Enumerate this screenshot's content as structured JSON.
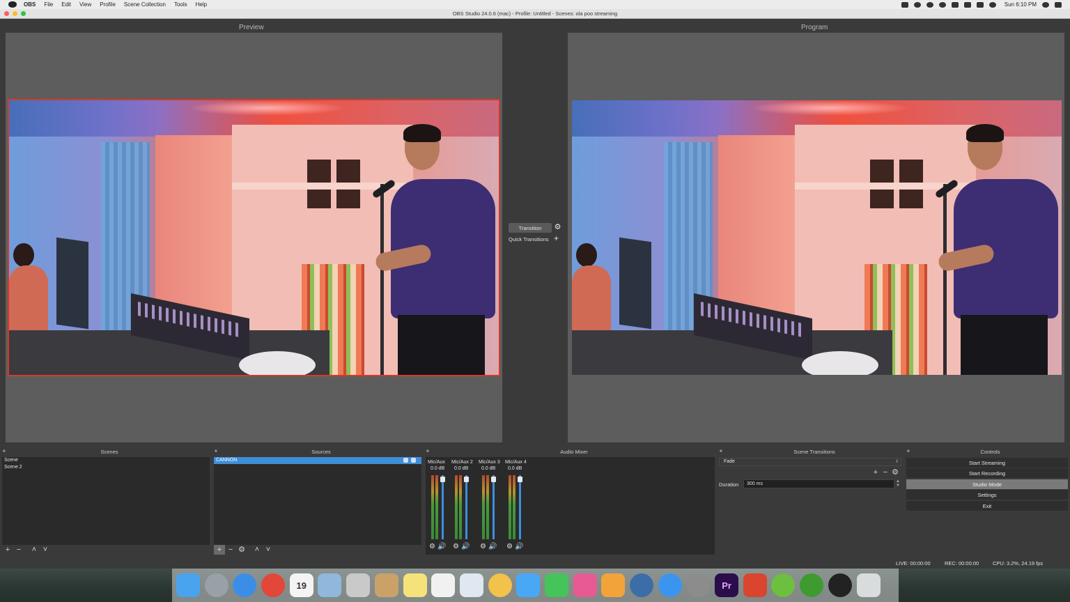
{
  "menubar": {
    "app_name": "OBS",
    "items": [
      "File",
      "Edit",
      "View",
      "Profile",
      "Scene Collection",
      "Tools",
      "Help"
    ],
    "clock": "Sun 6:10 PM"
  },
  "window": {
    "title": "OBS Studio 24.0.6 (mac) - Profile: Untitled - Scenes: ola poo streaming",
    "traffic_lights": [
      "#fc5f57",
      "#fdbc2e",
      "#28c840"
    ]
  },
  "preview": {
    "label": "Preview"
  },
  "program": {
    "label": "Program"
  },
  "transition": {
    "button_label": "Transition",
    "gear_icon": "⚙",
    "quick_label": "Quick Transitions",
    "quick_add_icon": "+"
  },
  "docks": {
    "scenes": {
      "title": "Scenes",
      "items": [
        "Scene",
        "Scene 2"
      ],
      "tools": [
        "+",
        "−",
        "˄",
        "˅"
      ]
    },
    "sources": {
      "title": "Sources",
      "items": [
        "CANNON"
      ],
      "tools": [
        "+",
        "−",
        "⚙",
        "˄",
        "˅"
      ]
    },
    "audio_mixer": {
      "title": "Audio Mixer",
      "channels": [
        {
          "name": "Mic/Aux",
          "db": "0.0 dB"
        },
        {
          "name": "Mic/Aux 2",
          "db": "0.0 dB"
        },
        {
          "name": "Mic/Aux 3",
          "db": "0.0 dB"
        },
        {
          "name": "Mic/Aux 4",
          "db": "0.0 dB"
        }
      ],
      "gear_icon": "⚙",
      "speaker_icon": "🔊"
    },
    "scene_transitions": {
      "title": "Scene Transitions",
      "selected": "Fade",
      "tools": [
        "+",
        "−",
        "⚙"
      ],
      "duration_label": "Duration",
      "duration_value": "300 ms"
    },
    "controls": {
      "title": "Controls",
      "buttons": [
        "Start Streaming",
        "Start Recording",
        "Studio Mode",
        "Settings",
        "Exit"
      ]
    }
  },
  "status": {
    "live": "LIVE: 00:00:00",
    "rec": "REC: 00:00:00",
    "cpu": "CPU: 3.2%, 24.19 fps"
  },
  "dock_icons": [
    {
      "name": "finder",
      "color": "#4aa3ef",
      "glyph": ""
    },
    {
      "name": "launchpad",
      "color": "#9aa0a8",
      "glyph": ""
    },
    {
      "name": "safari",
      "color": "#3a8ee6",
      "glyph": ""
    },
    {
      "name": "chrome",
      "color": "#e2473a",
      "glyph": ""
    },
    {
      "name": "calendar",
      "color": "#f4f4f4",
      "glyph": "19"
    },
    {
      "name": "preview-app",
      "color": "#8fb8dc",
      "glyph": ""
    },
    {
      "name": "disk-utility",
      "color": "#c9c9c9",
      "glyph": ""
    },
    {
      "name": "contacts",
      "color": "#caa267",
      "glyph": ""
    },
    {
      "name": "notes",
      "color": "#f6e27a",
      "glyph": ""
    },
    {
      "name": "reminders",
      "color": "#f1f1f1",
      "glyph": ""
    },
    {
      "name": "photo-booth",
      "color": "#dfe8f0",
      "glyph": ""
    },
    {
      "name": "photos",
      "color": "#f3c24a",
      "glyph": ""
    },
    {
      "name": "messages",
      "color": "#49a8f5",
      "glyph": ""
    },
    {
      "name": "facetime",
      "color": "#45c45a",
      "glyph": ""
    },
    {
      "name": "itunes",
      "color": "#e85a92",
      "glyph": ""
    },
    {
      "name": "ibooks",
      "color": "#f2a33a",
      "glyph": ""
    },
    {
      "name": "quicktime",
      "color": "#3b6ea8",
      "glyph": ""
    },
    {
      "name": "app-store",
      "color": "#3b95ef",
      "glyph": ""
    },
    {
      "name": "system-preferences",
      "color": "#8c8c8c",
      "glyph": ""
    },
    {
      "name": "premiere-pro",
      "color": "#2a0d4a",
      "glyph": "Pr"
    },
    {
      "name": "git-app",
      "color": "#d9452f",
      "glyph": ""
    },
    {
      "name": "utorrent",
      "color": "#6cbf3f",
      "glyph": ""
    },
    {
      "name": "studio-app",
      "color": "#3e9b2f",
      "glyph": ""
    },
    {
      "name": "obs",
      "color": "#222222",
      "glyph": ""
    },
    {
      "name": "trash",
      "color": "#d8dcdc",
      "glyph": ""
    }
  ]
}
